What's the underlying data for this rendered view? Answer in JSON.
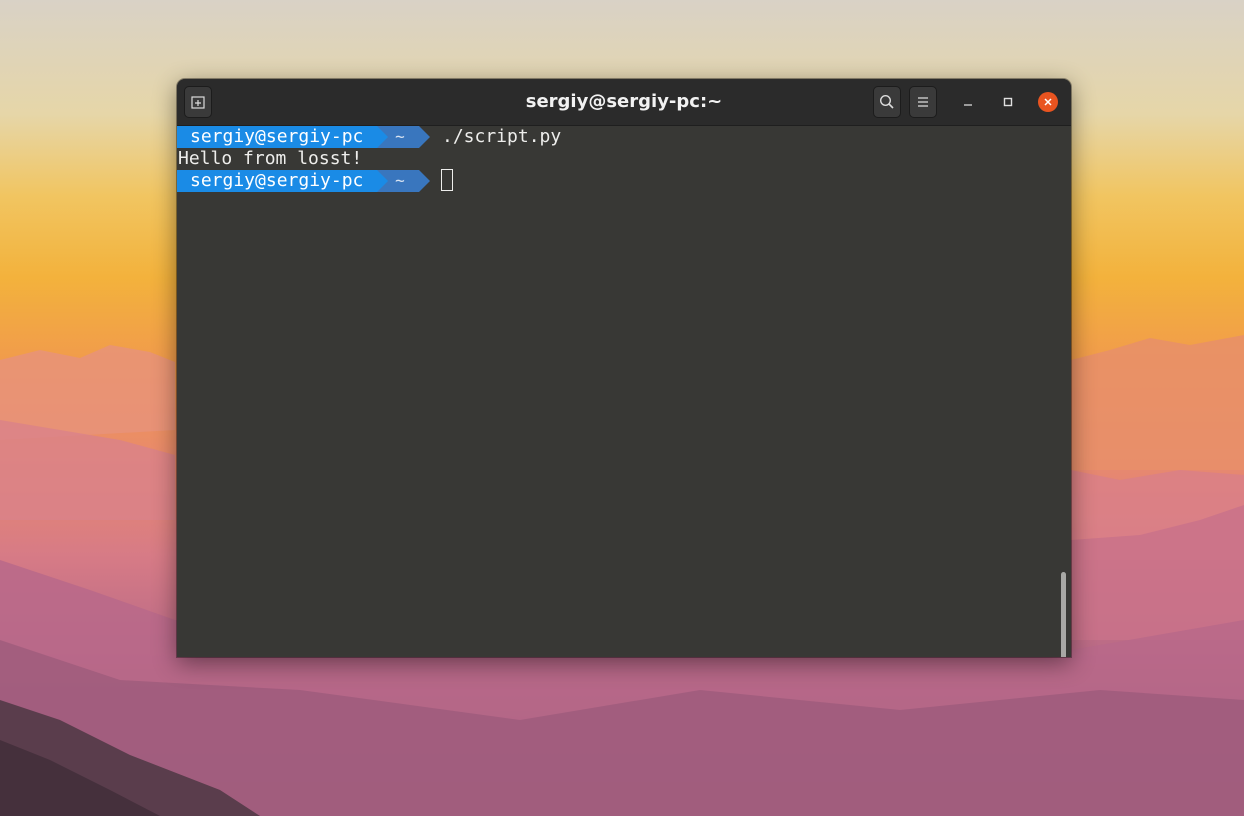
{
  "window": {
    "title": "sergiy@sergiy-pc:~"
  },
  "toolbar": {
    "new_tab_icon": "new-tab-icon",
    "search_icon": "search-icon",
    "menu_icon": "hamburger-menu-icon",
    "minimize_icon": "minimize-icon",
    "maximize_icon": "maximize-icon",
    "close_icon": "close-icon"
  },
  "terminal": {
    "prompt_user": "sergiy@sergiy-pc",
    "prompt_dir": "~",
    "command": "./script.py",
    "output": "Hello from losst!"
  },
  "colors": {
    "prompt_user_bg": "#1a8be6",
    "prompt_dir_bg": "#3976be",
    "terminal_bg": "#383835",
    "close_button": "#e95420"
  }
}
